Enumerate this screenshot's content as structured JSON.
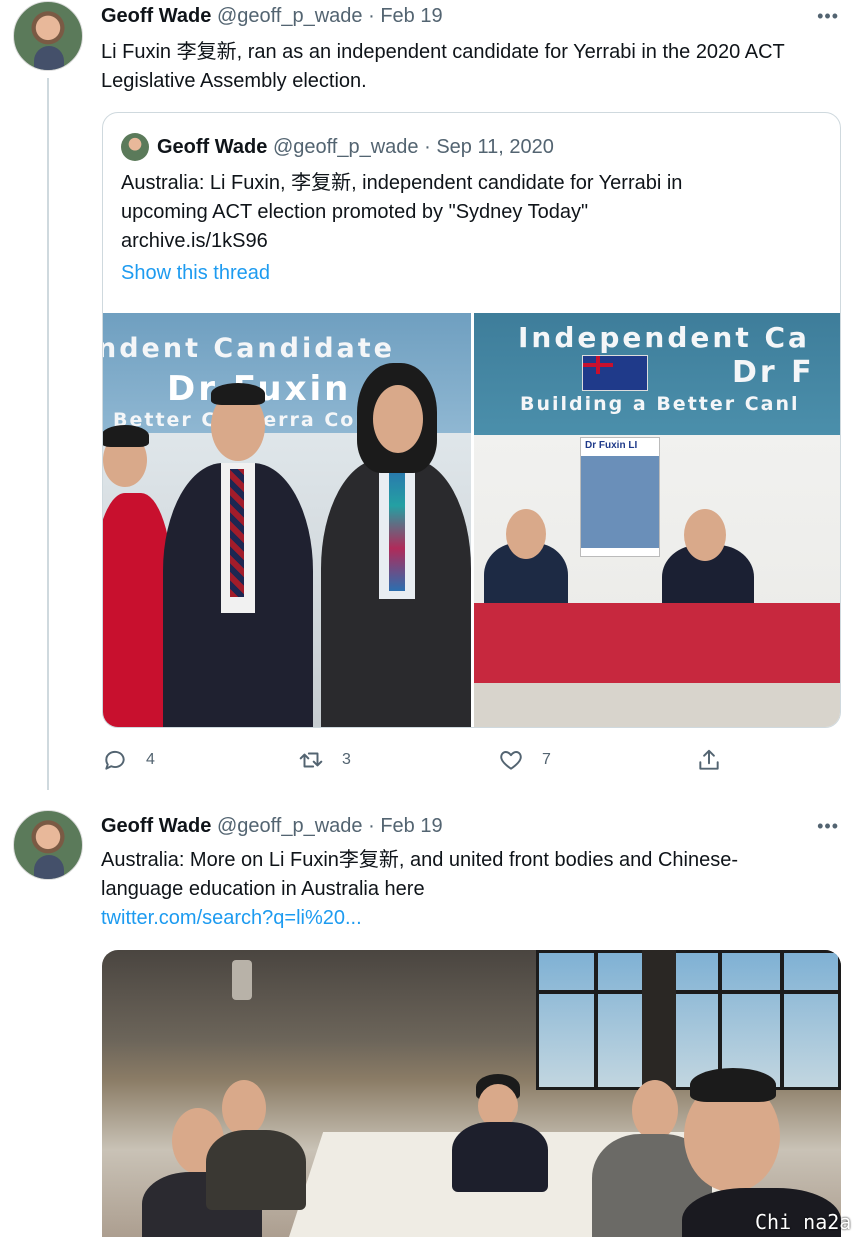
{
  "tweets": [
    {
      "name": "Geoff Wade",
      "handle": "@geoff_p_wade",
      "separator": "·",
      "date": "Feb 19",
      "more": "•••",
      "text": "Li Fuxin 李复新, ran as an independent candidate for Yerrabi in the 2020 ACT Legislative Assembly election.",
      "quote": {
        "name": "Geoff Wade",
        "handle": "@geoff_p_wade",
        "separator": "·",
        "date": "Sep 11, 2020",
        "text_line1": "Australia: Li Fuxin, 李复新, independent candidate for Yerrabi in",
        "text_line2": "upcoming ACT election promoted by \"Sydney Today\"",
        "link": "archive.is/1kS96",
        "show_thread": "Show this thread",
        "photo_left": {
          "banner1": "ndent Candidate",
          "banner2": "Dr Fuxin Li",
          "banner3": "Better Canberra Comm"
        },
        "photo_right": {
          "banner1": "Independent Ca",
          "banner2": "Dr F",
          "banner3": "Building a Better Canl",
          "poster": "Dr Fuxin LI"
        }
      },
      "actions": {
        "replies": "4",
        "retweets": "3",
        "likes": "7"
      }
    },
    {
      "name": "Geoff Wade",
      "handle": "@geoff_p_wade",
      "separator": "·",
      "date": "Feb 19",
      "more": "•••",
      "text_line1": "Australia: More on Li Fuxin李复新, and united front bodies and Chinese-",
      "text_line2": "language education in Australia  here",
      "link": "twitter.com/search?q=li%20..."
    }
  ],
  "watermark": "Chi na2a",
  "colors": {
    "link": "#1d9bf0",
    "muted": "#536471",
    "border": "#cfd9de"
  },
  "icons": [
    "reply-icon",
    "retweet-icon",
    "like-icon",
    "share-icon",
    "more-icon"
  ]
}
